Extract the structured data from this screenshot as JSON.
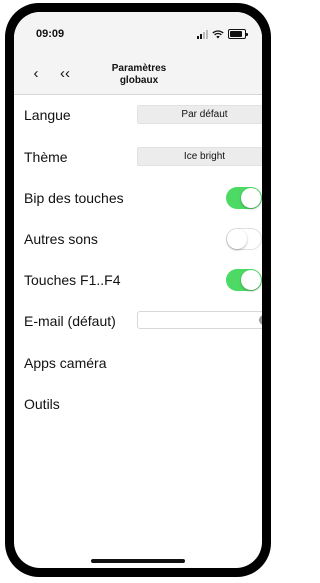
{
  "status_bar": {
    "time": "09:09"
  },
  "nav": {
    "back_glyph": "‹",
    "first_glyph": "‹‹",
    "title_line1": "Paramètres",
    "title_line2": "globaux"
  },
  "settings": {
    "language": {
      "label": "Langue",
      "value": "Par défaut"
    },
    "theme": {
      "label": "Thème",
      "value": "Ice bright"
    },
    "key_beep": {
      "label": "Bip des touches",
      "on": true
    },
    "other_sounds": {
      "label": "Autres sons",
      "on": false
    },
    "f_keys": {
      "label": "Touches F1..F4",
      "on": true
    },
    "email": {
      "label": "E-mail (défaut)",
      "value": "",
      "clear_glyph": "×"
    },
    "camera_apps": {
      "label": "Apps caméra",
      "chevron": "›"
    },
    "tools": {
      "label": "Outils",
      "chevron": "›"
    }
  },
  "colors": {
    "toggle_on": "#4cd964",
    "toggle_off": "#ffffff",
    "bar_bg": "#f4f4f4"
  }
}
